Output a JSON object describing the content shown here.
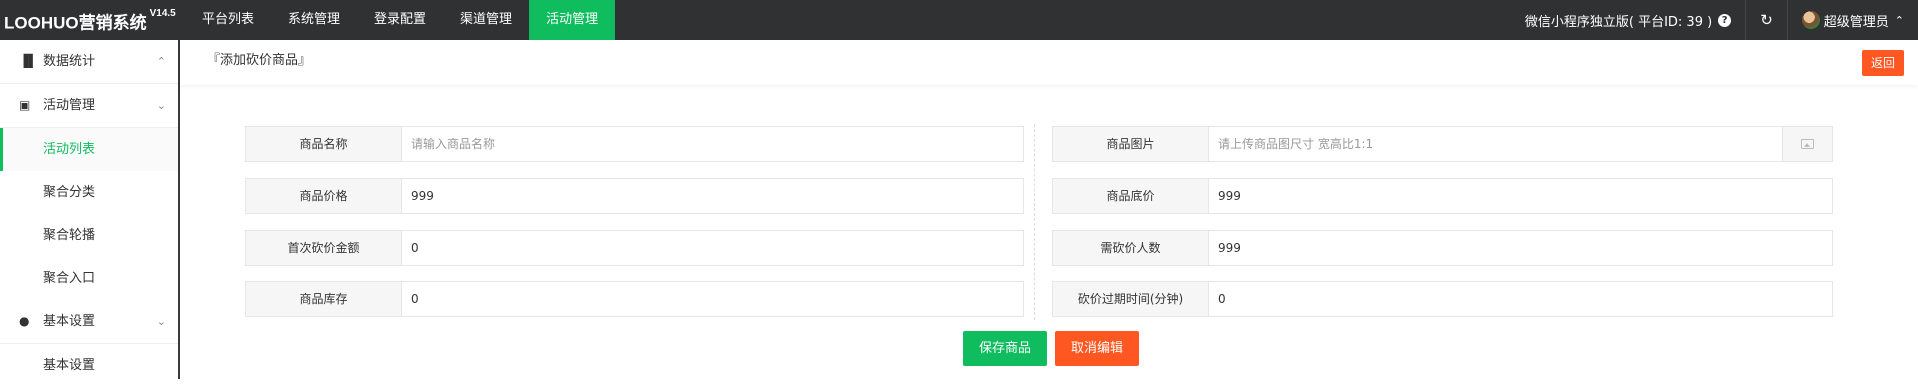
{
  "app": {
    "title": "LOOHUO营销系统",
    "version": "V14.5"
  },
  "nav": {
    "items": [
      "平台列表",
      "系统管理",
      "登录配置",
      "渠道管理",
      "活动管理"
    ],
    "active_index": 4
  },
  "topbar": {
    "app_info": "微信小程序独立版( 平台ID: 39 )",
    "help_icon": "question-circle-icon",
    "refresh_icon": "refresh-icon",
    "user_name": "超级管理员"
  },
  "sidebar": {
    "group_stats": {
      "label": "数据统计",
      "icon": "bar-chart-icon"
    },
    "group_activity": {
      "label": "活动管理",
      "icon": "briefcase-icon"
    },
    "activity_items": [
      "活动列表",
      "聚合分类",
      "聚合轮播",
      "聚合入口"
    ],
    "group_settings": {
      "label": "基本设置",
      "icon": "settings-icon"
    },
    "settings_items": [
      "基本设置"
    ]
  },
  "page": {
    "title": "『添加砍价商品』",
    "back_label": "返回"
  },
  "form": {
    "left": [
      {
        "label": "商品名称",
        "value": "",
        "placeholder": "请输入商品名称"
      },
      {
        "label": "商品价格",
        "value": "999"
      },
      {
        "label": "首次砍价金额",
        "value": "0"
      },
      {
        "label": "商品库存",
        "value": "0"
      }
    ],
    "right": [
      {
        "label": "商品图片",
        "value": "",
        "placeholder": "请上传商品图尺寸 宽高比1:1"
      },
      {
        "label": "商品底价",
        "value": "999"
      },
      {
        "label": "需砍价人数",
        "value": "999"
      },
      {
        "label": "砍价过期时间(分钟)",
        "value": "0"
      }
    ],
    "save_label": "保存商品",
    "cancel_label": "取消编辑"
  },
  "colors": {
    "accent": "#0fbd5f",
    "danger": "#ff5722",
    "topbar": "#2f3133"
  }
}
